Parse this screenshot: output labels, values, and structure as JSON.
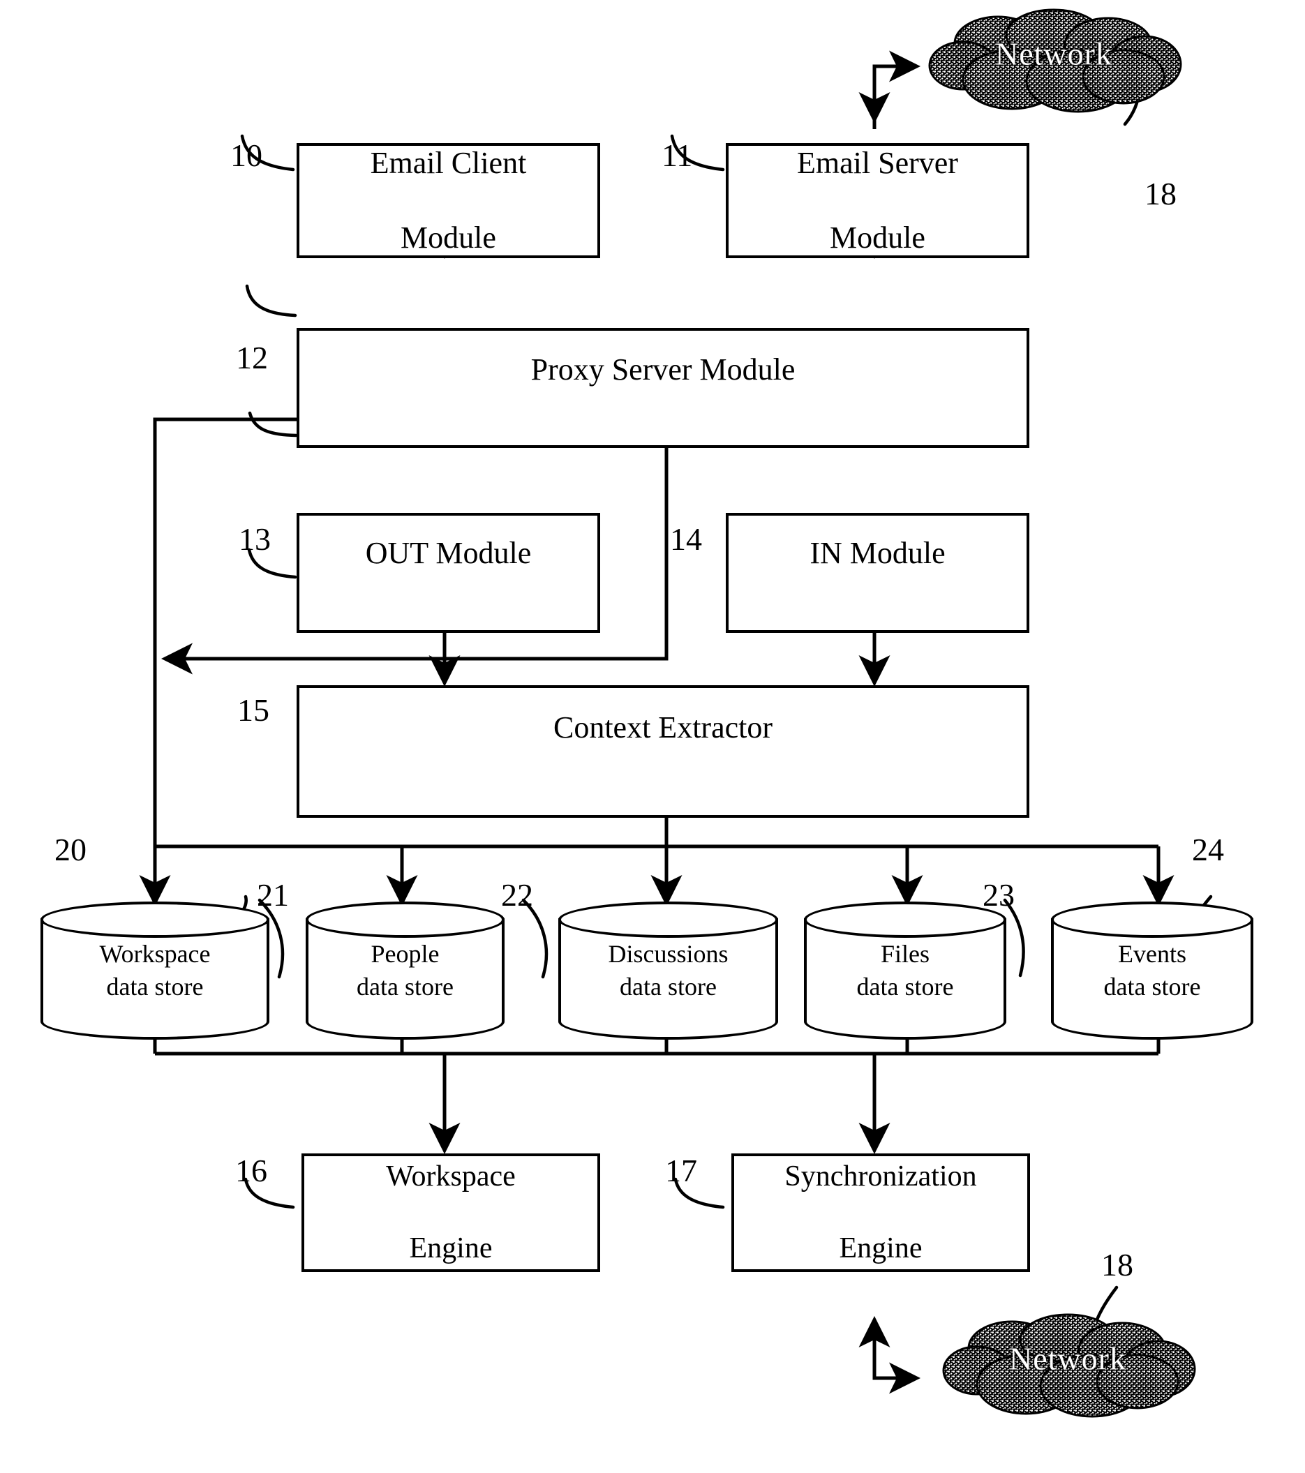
{
  "figure": {
    "type": "patent-block-diagram",
    "title": "Email collaboration system architecture"
  },
  "nodes": {
    "email_client": {
      "ref": "10",
      "label_line1": "Email Client",
      "label_line2": "Module"
    },
    "email_server": {
      "ref": "11",
      "label_line1": "Email Server",
      "label_line2": "Module"
    },
    "proxy_server": {
      "ref": "12",
      "label": "Proxy Server Module"
    },
    "out_module": {
      "ref": "13",
      "label": "OUT Module"
    },
    "in_module": {
      "ref": "14",
      "label": "IN Module"
    },
    "context_extractor": {
      "ref": "15",
      "label": "Context Extractor"
    },
    "workspace_engine": {
      "ref": "16",
      "label_line1": "Workspace",
      "label_line2": "Engine"
    },
    "sync_engine": {
      "ref": "17",
      "label_line1": "Synchronization",
      "label_line2": "Engine"
    },
    "network_top": {
      "ref": "18",
      "label": "Network"
    },
    "network_bottom": {
      "ref": "18",
      "label": "Network"
    }
  },
  "data_stores": [
    {
      "ref": "20",
      "line1": "Workspace",
      "line2": "data store"
    },
    {
      "ref": "21",
      "line1": "People",
      "line2": "data store"
    },
    {
      "ref": "22",
      "line1": "Discussions",
      "line2": "data store"
    },
    {
      "ref": "23",
      "line1": "Files",
      "line2": "data store"
    },
    {
      "ref": "24",
      "line1": "Events",
      "line2": "data store"
    }
  ],
  "colors": {
    "ink": "#000000",
    "paper": "#ffffff"
  }
}
